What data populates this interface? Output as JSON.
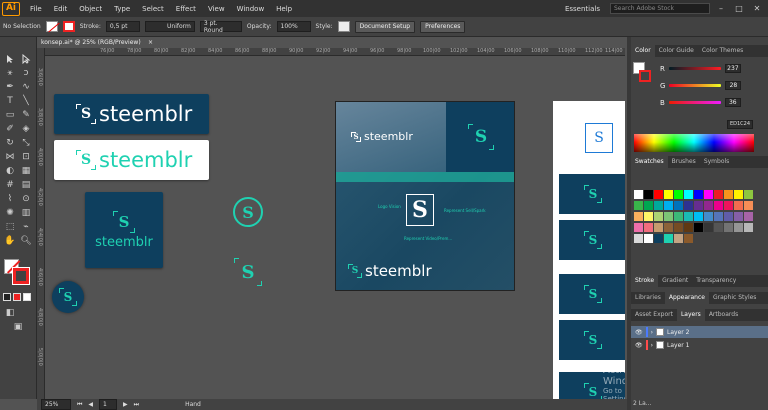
{
  "app": {
    "logo": "Ai"
  },
  "menu": [
    "File",
    "Edit",
    "Object",
    "Type",
    "Select",
    "Effect",
    "View",
    "Window",
    "Help"
  ],
  "workspace": "Essentials",
  "search_placeholder": "Search Adobe Stock",
  "control": {
    "selection": "No Selection",
    "stroke_label": "Stroke:",
    "stroke_value": "0,5 pt",
    "profile": "Uniform",
    "brush": "3 pt. Round",
    "opacity_label": "Opacity:",
    "opacity_value": "100%",
    "style_label": "Style:",
    "doc_setup": "Document Setup",
    "preferences": "Preferences"
  },
  "document": {
    "tab": "konsep.ai* @ 25% (RGB/Preview)",
    "close": "×"
  },
  "ruler_h": [
    "76|00",
    "78|00",
    "80|00",
    "82|00",
    "84|00",
    "86|00",
    "88|00",
    "90|00",
    "92|00",
    "94|00",
    "96|00",
    "98|00",
    "100|00",
    "102|00",
    "104|00",
    "106|00",
    "108|00",
    "110|00",
    "112|00",
    "114|00",
    "116|00"
  ],
  "ruler_v": [
    "3|6|0|0",
    "3|8|0|0",
    "4|0|0|0",
    "4|2|0|0",
    "4|4|0|0",
    "4|6|0|0",
    "4|8|0|0",
    "5|0|0|0"
  ],
  "artboard": {
    "brand": "steemblr",
    "labels": [
      "Logo Vision",
      "Represent Sell/Spark",
      "Represent Video/Prem..."
    ],
    "colors": {
      "dark": "#0E3F5E",
      "teal": "#1FD1B1",
      "white": "#FFFFFF"
    }
  },
  "status": {
    "zoom": "25%",
    "page": "1",
    "tool": "Hand"
  },
  "panels": {
    "color_tabs": [
      "Color",
      "Color Guide",
      "Color Themes"
    ],
    "sliders": [
      {
        "ch": "R",
        "value": "237",
        "color": "#ED1C24"
      },
      {
        "ch": "G",
        "value": "28",
        "color": "#ED1C24"
      },
      {
        "ch": "B",
        "value": "36",
        "color": "#ED1C24"
      }
    ],
    "hex": "ED1C24",
    "swatch_tabs": [
      "Swatches",
      "Brushes",
      "Symbols"
    ],
    "stroke_tabs": [
      "Stroke",
      "Gradient",
      "Transparency"
    ],
    "lib_tabs": [
      "Libraries",
      "Appearance",
      "Graphic Styles"
    ],
    "layer_tabs": [
      "Asset Export",
      "Layers",
      "Artboards"
    ],
    "layers": [
      {
        "name": "Layer 2",
        "color": "#4b7bff"
      },
      {
        "name": "Layer 1",
        "color": "#ff4b4b"
      }
    ],
    "layers_count": "2 La..."
  },
  "activation": {
    "title": "Activate Windows",
    "sub": "Go to Settings to activate Windows."
  }
}
